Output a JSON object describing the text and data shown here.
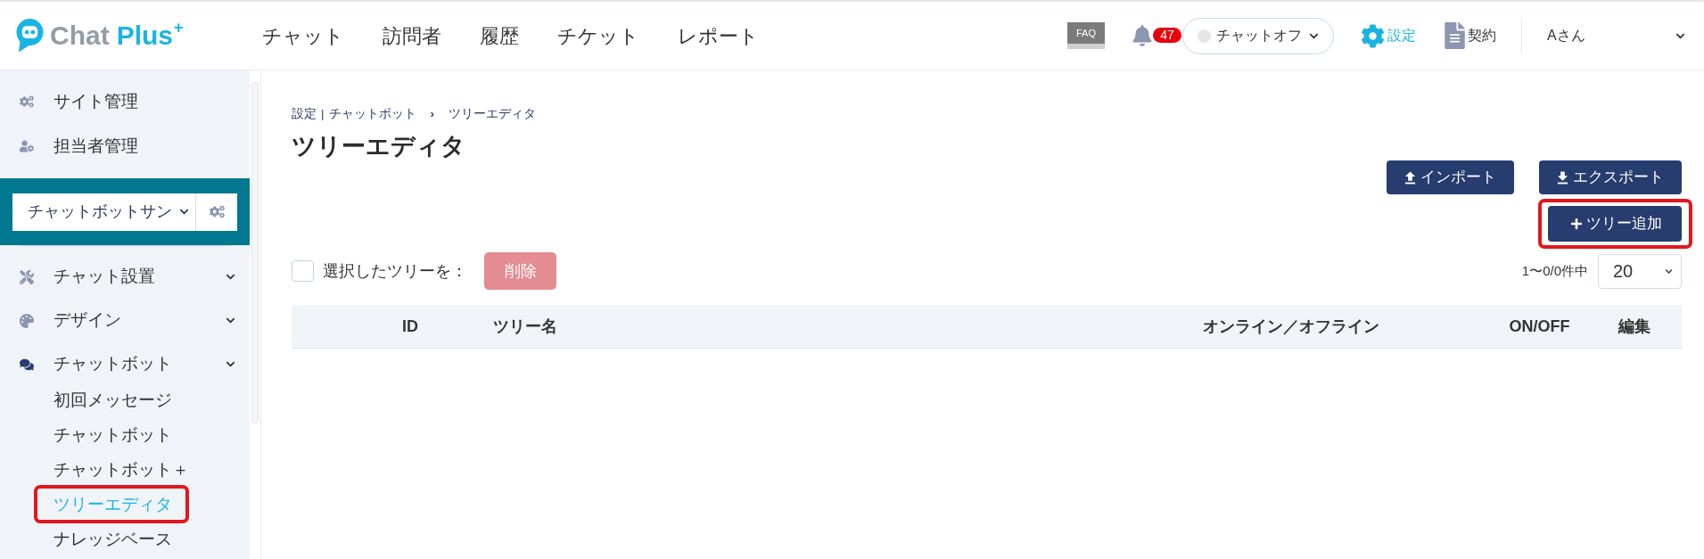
{
  "header": {
    "logo": {
      "text": "Chat",
      "accent_text": "Plus",
      "superscript": "+"
    },
    "nav": [
      {
        "label": "チャット"
      },
      {
        "label": "訪問者"
      },
      {
        "label": "履歴"
      },
      {
        "label": "チケット"
      },
      {
        "label": "レポート"
      }
    ],
    "faq": {
      "label": "FAQ"
    },
    "notifications": {
      "count": "47"
    },
    "chat_status": {
      "label": "チャットオフ",
      "online": false
    },
    "settings_link": {
      "label": "設定",
      "selected": true
    },
    "contract_link": {
      "label": "契約",
      "selected": false
    },
    "user_menu": {
      "label": "Aさん"
    }
  },
  "sidebar": {
    "top_items": [
      {
        "label": "サイト管理"
      },
      {
        "label": "担当者管理"
      }
    ],
    "site_select": {
      "value": "チャットボットサン"
    },
    "sections": [
      {
        "label": "チャット設置",
        "selected": false
      },
      {
        "label": "デザイン",
        "selected": false
      },
      {
        "label": "チャットボット",
        "selected": true,
        "children": [
          {
            "label": "初回メッセージ",
            "selected": false,
            "highlighted": false
          },
          {
            "label": "チャットボット",
            "selected": false,
            "highlighted": false
          },
          {
            "label": "チャットボット＋",
            "selected": false,
            "highlighted": false
          },
          {
            "label": "ツリーエディタ",
            "selected": true,
            "highlighted": true
          },
          {
            "label": "ナレッジベース",
            "selected": false,
            "highlighted": false
          }
        ]
      }
    ]
  },
  "main": {
    "breadcrumb": [
      {
        "label": "設定",
        "kind": "link"
      },
      {
        "label": "|",
        "kind": "pipe"
      },
      {
        "label": "チャットボット",
        "kind": "link"
      },
      {
        "label": "›",
        "kind": "chevron"
      },
      {
        "label": "ツリーエディタ",
        "kind": "current"
      }
    ],
    "title": "ツリーエディタ",
    "actions": [
      {
        "label": "インポート",
        "kind": "import"
      },
      {
        "label": "エクスポート",
        "kind": "export"
      }
    ],
    "add_button": {
      "label": "ツリー追加",
      "highlighted": true
    },
    "bulk_action": {
      "checked": false,
      "label": "選択したツリーを：",
      "button": {
        "label": "削除",
        "disabled": true
      }
    },
    "pagination": {
      "summary": "1〜0/0件中",
      "page_size": "20"
    },
    "table": {
      "columns": [
        "ID",
        "ツリー名",
        "オンライン／オフライン",
        "ON/OFF",
        "編集"
      ]
    }
  }
}
